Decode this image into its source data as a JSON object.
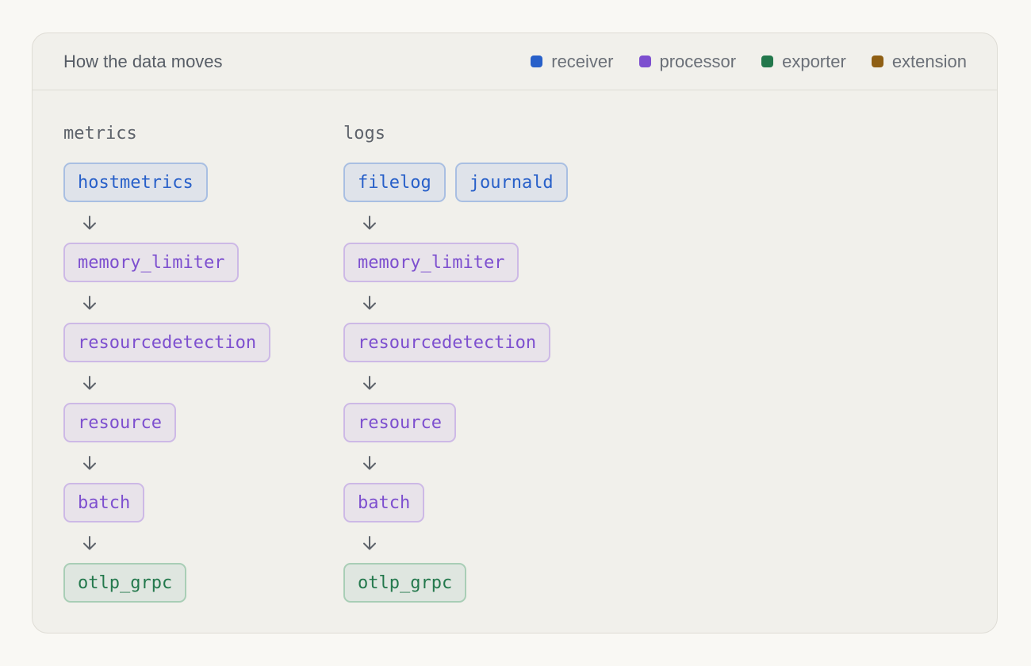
{
  "header": {
    "title": "How the data moves"
  },
  "legend": [
    {
      "label": "receiver",
      "color": "#2860c9"
    },
    {
      "label": "processor",
      "color": "#7d4fcf"
    },
    {
      "label": "exporter",
      "color": "#23784c"
    },
    {
      "label": "extension",
      "color": "#8f5f14"
    }
  ],
  "pipelines": [
    {
      "name": "metrics",
      "stages": [
        {
          "kind": "receiver",
          "nodes": [
            "hostmetrics"
          ]
        },
        {
          "kind": "processor",
          "nodes": [
            "memory_limiter"
          ]
        },
        {
          "kind": "processor",
          "nodes": [
            "resourcedetection"
          ]
        },
        {
          "kind": "processor",
          "nodes": [
            "resource"
          ]
        },
        {
          "kind": "processor",
          "nodes": [
            "batch"
          ]
        },
        {
          "kind": "exporter",
          "nodes": [
            "otlp_grpc"
          ]
        }
      ]
    },
    {
      "name": "logs",
      "stages": [
        {
          "kind": "receiver",
          "nodes": [
            "filelog",
            "journald"
          ]
        },
        {
          "kind": "processor",
          "nodes": [
            "memory_limiter"
          ]
        },
        {
          "kind": "processor",
          "nodes": [
            "resourcedetection"
          ]
        },
        {
          "kind": "processor",
          "nodes": [
            "resource"
          ]
        },
        {
          "kind": "processor",
          "nodes": [
            "batch"
          ]
        },
        {
          "kind": "exporter",
          "nodes": [
            "otlp_grpc"
          ]
        }
      ]
    }
  ]
}
